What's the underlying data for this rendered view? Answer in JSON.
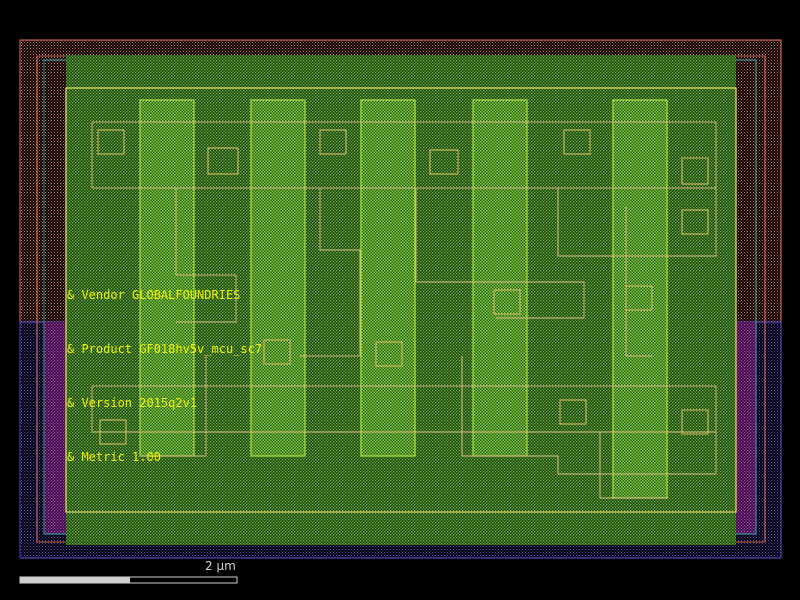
{
  "cell": {
    "labels": {
      "vendor": "& Vendor GLOBALFOUNDRIES",
      "product": "& Product GF018hv5v_mcu_sc7",
      "version": "& Version 2015q2v1",
      "metric": "& Metric 1.00"
    }
  },
  "scale_bar": {
    "label": "2 µm"
  },
  "colors": {
    "background": "#000000",
    "nwell": "#e07060",
    "pwell": "#5a4ad0",
    "diffusion": "#9a30c0",
    "metal1": "#40b040",
    "poly": "#b0e040",
    "outline": "#e8e060",
    "label": "#f0f000"
  }
}
